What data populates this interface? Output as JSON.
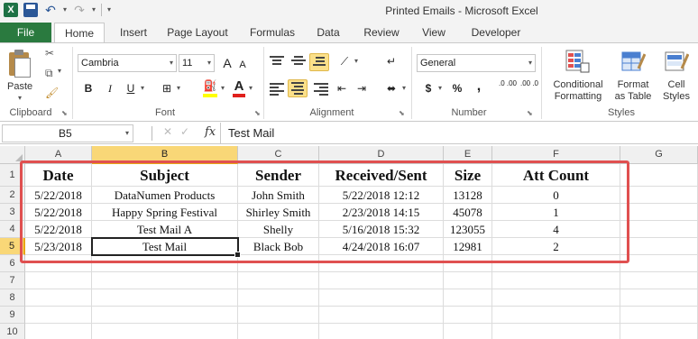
{
  "window": {
    "title": "Printed Emails  -  Microsoft Excel"
  },
  "tabs": [
    "File",
    "Home",
    "Insert",
    "Page Layout",
    "Formulas",
    "Data",
    "Review",
    "View",
    "Developer"
  ],
  "ribbon": {
    "clipboard": {
      "paste": "Paste",
      "label": "Clipboard"
    },
    "font": {
      "name": "Cambria",
      "size": "11",
      "bold": "B",
      "italic": "I",
      "underline": "U",
      "grow": "A",
      "shrink": "A",
      "label": "Font"
    },
    "alignment": {
      "label": "Alignment"
    },
    "number": {
      "format": "General",
      "currency": "$",
      "percent": "%",
      "comma": ",",
      "inc_decimal": ".0 .00",
      "dec_decimal": ".00 .0",
      "label": "Number"
    },
    "styles": {
      "conditional": "Conditional\nFormatting",
      "format_table": "Format\nas Table",
      "cell_styles": "Cell\nStyles",
      "label": "Styles"
    },
    "colors": {
      "highlight": "#ffff00",
      "font_color": "#e0201c"
    }
  },
  "formula_bar": {
    "name_box": "B5",
    "fx": "fx",
    "content": "Test Mail"
  },
  "grid": {
    "columns": [
      "A",
      "B",
      "C",
      "D",
      "E",
      "F",
      "G"
    ],
    "selected_column": "B",
    "rows": [
      "1",
      "2",
      "3",
      "4",
      "5",
      "6",
      "7",
      "8",
      "9",
      "10"
    ],
    "selected_row": "5",
    "header": [
      "Date",
      "Subject",
      "Sender",
      "Received/Sent",
      "Size",
      "Att Count"
    ],
    "data": [
      [
        "5/22/2018",
        "DataNumen Products",
        "John Smith",
        "5/22/2018 12:12",
        "13128",
        "0"
      ],
      [
        "5/22/2018",
        "Happy Spring Festival",
        "Shirley Smith",
        "2/23/2018 14:15",
        "45078",
        "1"
      ],
      [
        "5/22/2018",
        "Test Mail A",
        "Shelly",
        "5/16/2018 15:32",
        "123055",
        "4"
      ],
      [
        "5/23/2018",
        "Test Mail",
        "Black Bob",
        "4/24/2018 16:07",
        "12981",
        "2"
      ]
    ],
    "highlight_color": "#e05050"
  }
}
